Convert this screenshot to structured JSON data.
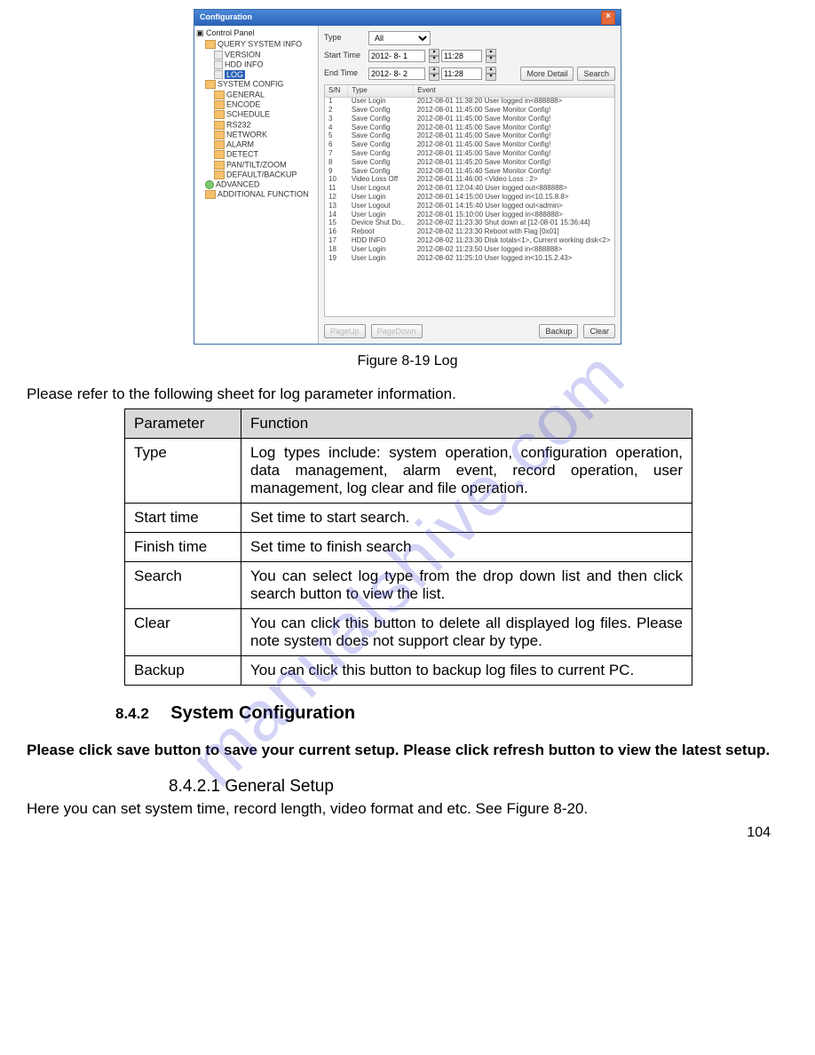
{
  "watermark": "manualshive.com",
  "page_number": "104",
  "config_window": {
    "title": "Configuration",
    "tree_root": "Control Panel",
    "tree": [
      {
        "label": "QUERY SYSTEM INFO",
        "icon": "folder",
        "children": [
          {
            "label": "VERSION",
            "icon": "doc"
          },
          {
            "label": "HDD INFO",
            "icon": "doc"
          },
          {
            "label": "LOG",
            "icon": "doc",
            "selected": true
          }
        ]
      },
      {
        "label": "SYSTEM CONFIG",
        "icon": "folder",
        "children": [
          {
            "label": "GENERAL",
            "icon": "folder"
          },
          {
            "label": "ENCODE",
            "icon": "folder"
          },
          {
            "label": "SCHEDULE",
            "icon": "folder"
          },
          {
            "label": "RS232",
            "icon": "folder"
          },
          {
            "label": "NETWORK",
            "icon": "folder"
          },
          {
            "label": "ALARM",
            "icon": "folder"
          },
          {
            "label": "DETECT",
            "icon": "folder"
          },
          {
            "label": "PAN/TILT/ZOOM",
            "icon": "folder"
          },
          {
            "label": "DEFAULT/BACKUP",
            "icon": "folder"
          }
        ]
      },
      {
        "label": "ADVANCED",
        "icon": "green"
      },
      {
        "label": "ADDITIONAL FUNCTION",
        "icon": "folder"
      }
    ],
    "filters": {
      "type_label": "Type",
      "type_value": "All",
      "start_label": "Start Time",
      "start_date": "2012- 8- 1",
      "start_time": "11:28",
      "end_label": "End Time",
      "end_date": "2012- 8- 2",
      "end_time": "11:28",
      "more_detail": "More Detail",
      "search": "Search"
    },
    "columns": {
      "sn": "S/N",
      "type": "Type",
      "event": "Event"
    },
    "rows": [
      {
        "n": "1",
        "t": "User Login",
        "e": "2012-08-01 11:38:20   User logged in<888888>"
      },
      {
        "n": "2",
        "t": "Save Config",
        "e": "2012-08-01 11:45:00   Save Monitor Config!"
      },
      {
        "n": "3",
        "t": "Save Config",
        "e": "2012-08-01 11:45:00   Save Monitor Config!"
      },
      {
        "n": "4",
        "t": "Save Config",
        "e": "2012-08-01 11:45:00   Save Monitor Config!"
      },
      {
        "n": "5",
        "t": "Save Config",
        "e": "2012-08-01 11:45:00   Save Monitor Config!"
      },
      {
        "n": "6",
        "t": "Save Config",
        "e": "2012-08-01 11:45:00   Save Monitor Config!"
      },
      {
        "n": "7",
        "t": "Save Config",
        "e": "2012-08-01 11:45:00   Save Monitor Config!"
      },
      {
        "n": "8",
        "t": "Save Config",
        "e": "2012-08-01 11:45:20   Save Monitor Config!"
      },
      {
        "n": "9",
        "t": "Save Config",
        "e": "2012-08-01 11:45:40   Save Monitor Config!"
      },
      {
        "n": "10",
        "t": "Video Loss Off",
        "e": "2012-08-01 11:46:00   <Video Loss : 2>"
      },
      {
        "n": "11",
        "t": "User Logout",
        "e": "2012-08-01 12:04:40   User logged out<888888>"
      },
      {
        "n": "12",
        "t": "User Login",
        "e": "2012-08-01 14:15:00   User logged in<10.15.8.8>"
      },
      {
        "n": "13",
        "t": "User Logout",
        "e": "2012-08-01 14:15:40   User logged out<admin>"
      },
      {
        "n": "14",
        "t": "User Login",
        "e": "2012-08-01 15:10:00   User logged in<888888>"
      },
      {
        "n": "15",
        "t": "Device Shut Do..",
        "e": "2012-08-02 11:23:30   Shut down at [12-08-01 15:36:44]"
      },
      {
        "n": "16",
        "t": "Reboot",
        "e": "2012-08-02 11:23:30   Reboot with Flag [0x01]"
      },
      {
        "n": "17",
        "t": "HDD INFO",
        "e": "2012-08-02 11:23:30   Disk totals<1>, Current working disk<2>"
      },
      {
        "n": "18",
        "t": "User Login",
        "e": "2012-08-02 11:23:50   User logged in<888888>"
      },
      {
        "n": "19",
        "t": "User Login",
        "e": "2012-08-02 11:25:10   User logged in<10.15.2.43>"
      }
    ],
    "footer": {
      "page_up": "PageUp",
      "page_down": "PageDown",
      "backup": "Backup",
      "clear": "Clear"
    }
  },
  "figure_caption": "Figure 8-19 Log",
  "intro_text": "Please refer to the following sheet for log parameter information.",
  "param_table": {
    "head": {
      "param": "Parameter",
      "func": "Function"
    },
    "rows": [
      {
        "p": "Type",
        "f": "Log types include: system operation, configuration operation, data management, alarm event, record operation, user management, log clear and file operation."
      },
      {
        "p": "Start time",
        "f": "Set time to start search."
      },
      {
        "p": "Finish time",
        "f": "Set time to finish search"
      },
      {
        "p": "Search",
        "f": "You can select log type from the drop down list and then click search button to view the list."
      },
      {
        "p": "Clear",
        "f": "You can click this button to delete all displayed log files.    Please note system does not support clear by type."
      },
      {
        "p": "Backup",
        "f": "You can click this button to backup log files to current PC."
      }
    ]
  },
  "section": {
    "num": "8.4.2",
    "title": "System Configuration",
    "bold_para": "Please click save button to save your current setup. Please click refresh button to view the latest setup.",
    "sub_num_title": "8.4.2.1  General Setup",
    "sub_text": "Here you can set system time, record length, video format and etc. See Figure 8-20."
  }
}
